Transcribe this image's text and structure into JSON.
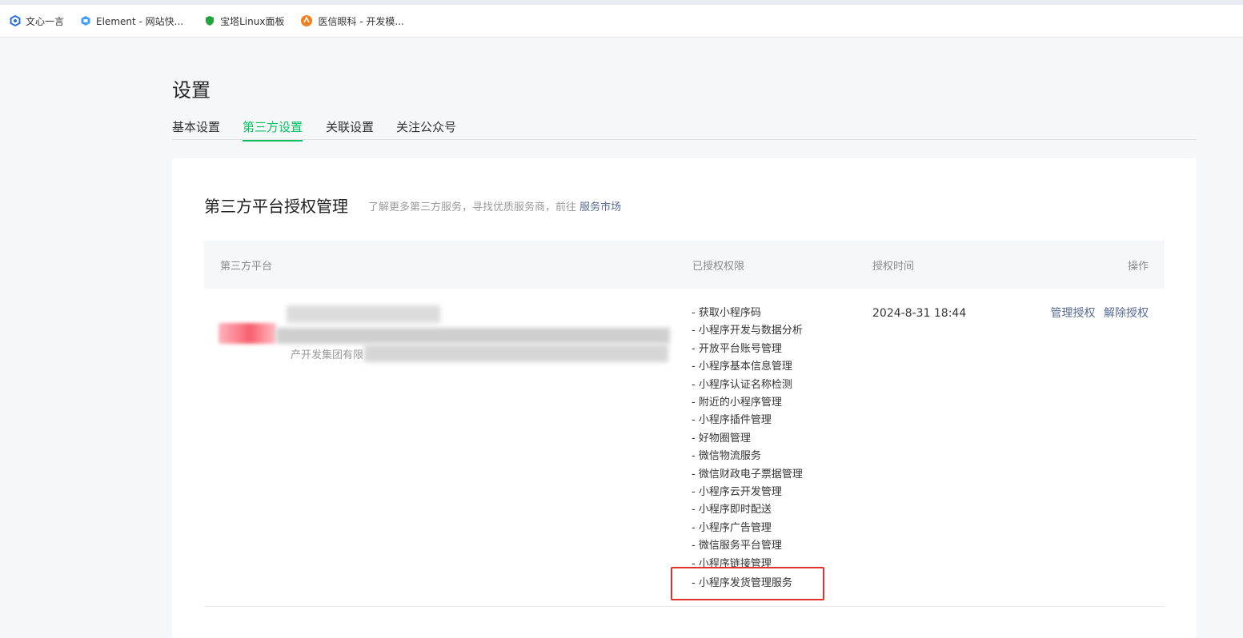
{
  "bookmarks": [
    {
      "label": "文心一言",
      "icon": "wenxin-icon"
    },
    {
      "label": "Element - 网站快...",
      "icon": "element-icon"
    },
    {
      "label": "宝塔Linux面板",
      "icon": "baota-shield-icon"
    },
    {
      "label": "医信眼科 - 开发模...",
      "icon": "yixin-icon"
    }
  ],
  "page": {
    "title": "设置"
  },
  "tabs": [
    {
      "label": "基本设置",
      "active": false
    },
    {
      "label": "第三方设置",
      "active": true
    },
    {
      "label": "关联设置",
      "active": false
    },
    {
      "label": "关注公众号",
      "active": false
    }
  ],
  "section": {
    "title": "第三方平台授权管理",
    "tip": "了解更多第三方服务，寻找优质服务商，前往",
    "tip_link": "服务市场"
  },
  "table": {
    "columns": {
      "platform": "第三方平台",
      "permissions": "已授权权限",
      "time": "授权时间",
      "actions": "操作"
    },
    "row": {
      "company_desc": "产开发集团有限",
      "auth_time": "2024-8-31 18:44",
      "manage_label": "管理授权",
      "revoke_label": "解除授权",
      "permissions": [
        "- 获取小程序码",
        "- 小程序开发与数据分析",
        "- 开放平台账号管理",
        "- 小程序基本信息管理",
        "- 小程序认证名称检测",
        "- 附近的小程序管理",
        "- 小程序插件管理",
        "- 好物圈管理",
        "- 微信物流服务",
        "- 微信财政电子票据管理",
        "- 小程序云开发管理",
        "- 小程序即时配送",
        "- 小程序广告管理",
        "- 微信服务平台管理",
        "- 小程序链接管理",
        "- 小程序发货管理服务"
      ]
    }
  },
  "colors": {
    "accent": "#07c160",
    "link": "#576b95",
    "highlight": "#e5312d"
  }
}
